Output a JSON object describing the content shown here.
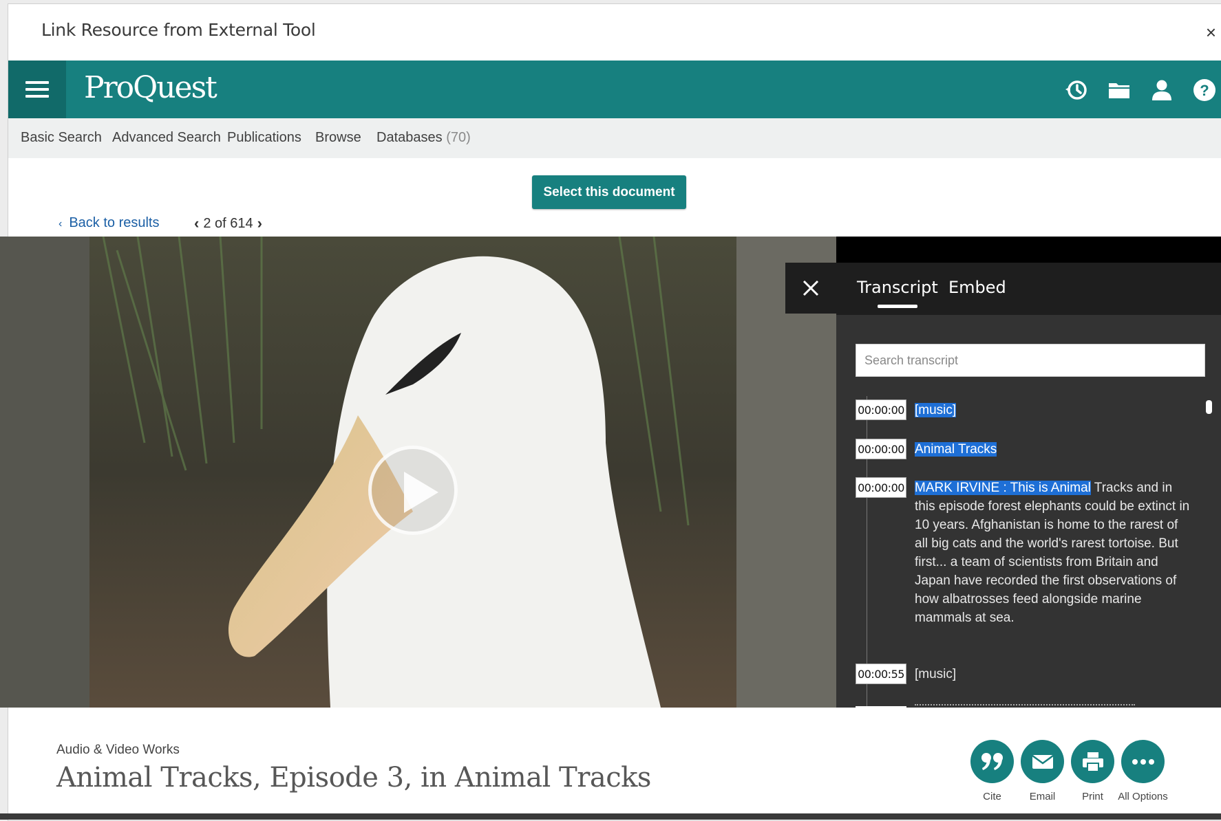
{
  "dialog": {
    "title": "Link Resource from External Tool",
    "close": "×"
  },
  "header": {
    "logo": "ProQuest"
  },
  "nav": [
    {
      "label": "Basic Search"
    },
    {
      "label": "Advanced Search"
    },
    {
      "label": "Publications"
    },
    {
      "label": "Browse"
    },
    {
      "label": "Databases",
      "count": "(70)"
    }
  ],
  "actions_row": {
    "select_label": "Select this document",
    "back_label": "Back to results",
    "pager": "2 of 614"
  },
  "transcript": {
    "tabs": [
      "Transcript",
      "Embed"
    ],
    "search_placeholder": "Search transcript",
    "entries": [
      {
        "time": "00:00:00",
        "highlight": "[music]",
        "rest": ""
      },
      {
        "time": "00:00:00",
        "highlight": "Animal Tracks",
        "rest": ""
      },
      {
        "time": "00:00:00",
        "highlight": "MARK IRVINE : This is Animal",
        "rest": " Tracks and in this episode forest elephants could be extinct in 10 years. Afghanistan is home to the rarest of all big cats and the world's rarest tortoise. But first... a team of scientists from Britain and Japan have recorded the first observations of how albatrosses feed alongside marine mammals at sea."
      },
      {
        "time": "00:00:55",
        "highlight": "",
        "rest": "[music]"
      }
    ]
  },
  "document": {
    "type": "Audio & Video Works",
    "title": "Animal Tracks, Episode 3, in Animal Tracks"
  },
  "doc_actions": [
    {
      "label": "Cite",
      "icon": "quote-icon"
    },
    {
      "label": "Email",
      "icon": "envelope-icon"
    },
    {
      "label": "Print",
      "icon": "printer-icon"
    },
    {
      "label": "All Options",
      "icon": "more-icon"
    }
  ],
  "colors": {
    "brand": "#17807f",
    "brand_dark": "#116a69",
    "highlight": "#1e6fd6",
    "link": "#1b5fa5"
  }
}
